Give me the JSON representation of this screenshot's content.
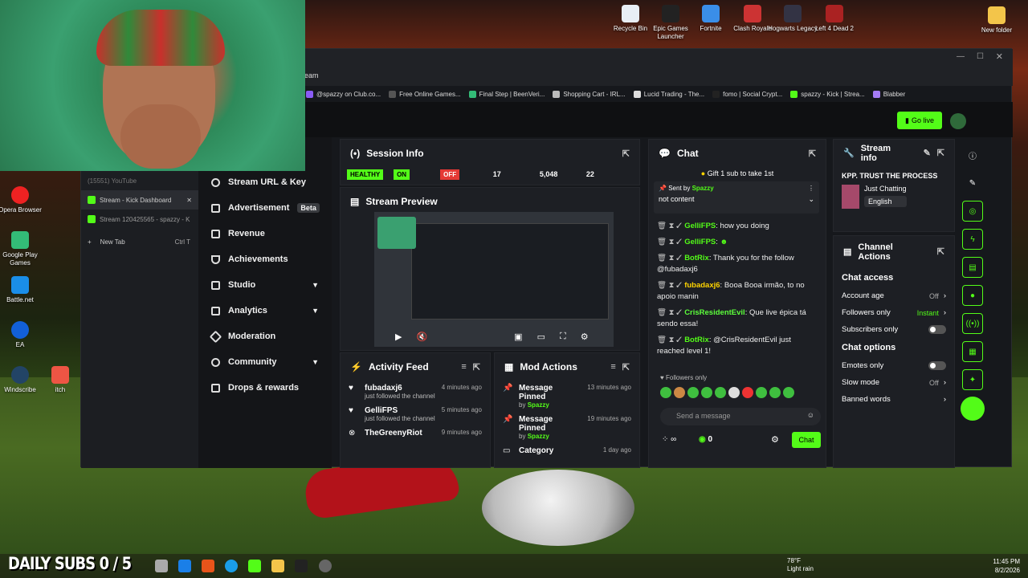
{
  "desktop": {
    "top_icons": [
      {
        "label": "Recycle Bin"
      },
      {
        "label": "Epic Games Launcher"
      },
      {
        "label": "Fortnite"
      },
      {
        "label": "Clash Royale"
      },
      {
        "label": "Hogwarts Legacy"
      },
      {
        "label": "Left 4 Dead 2"
      }
    ],
    "right_icon": "New folder",
    "left_icons": [
      {
        "label": "Opera Browser"
      },
      {
        "label": "Google Play Games"
      },
      {
        "label": "Battle.net"
      },
      {
        "label": "EA"
      },
      {
        "label": "Windscribe"
      },
      {
        "label": "itch"
      }
    ]
  },
  "browser": {
    "address": "eam",
    "bookmarks": [
      "@spazzy on Club.co...",
      "Free Online Games...",
      "Final Step | BeenVeri...",
      "Shopping Cart - IRL...",
      "Lucid Trading - The...",
      "fomo | Social Crypt...",
      "spazzy - Kick | Strea...",
      "Blabber"
    ],
    "tabs": [
      {
        "label": "(15551) YouTube"
      },
      {
        "label": "Stream - Kick Dashboard"
      },
      {
        "label": "Stream 120425565 - spazzy - K"
      }
    ],
    "new_tab": "New Tab",
    "new_tab_shortcut": "Ctrl  T"
  },
  "header": {
    "go_live": "Go live"
  },
  "nav": {
    "items": [
      {
        "label": "Stream URL & Key"
      },
      {
        "label": "Advertisement",
        "badge": "Beta"
      },
      {
        "label": "Revenue"
      },
      {
        "label": "Achievements"
      },
      {
        "label": "Studio"
      },
      {
        "label": "Analytics"
      },
      {
        "label": "Moderation"
      },
      {
        "label": "Community"
      },
      {
        "label": "Drops & rewards"
      }
    ]
  },
  "session": {
    "title": "Session Info",
    "health": "HEALTHY",
    "on": "ON",
    "off": "OFF",
    "stats": [
      "17",
      "5,048",
      "22"
    ]
  },
  "preview": {
    "title": "Stream Preview"
  },
  "activity": {
    "title": "Activity Feed",
    "rows": [
      {
        "name": "fubadaxj6",
        "sub": "just followed the channel",
        "time": "4 minutes ago"
      },
      {
        "name": "GelliFPS",
        "sub": "just followed the channel",
        "time": "5 minutes ago"
      },
      {
        "name": "TheGreenyRiot",
        "sub": "",
        "time": "9 minutes ago"
      }
    ]
  },
  "mod": {
    "title": "Mod Actions",
    "rows": [
      {
        "name": "Message Pinned",
        "by": "by",
        "user": "Spazzy",
        "time": "13 minutes ago"
      },
      {
        "name": "Message Pinned",
        "by": "by",
        "user": "Spazzy",
        "time": "19 minutes ago"
      },
      {
        "name": "Category",
        "by": "",
        "user": "",
        "time": "1 day ago"
      }
    ]
  },
  "chat": {
    "title": "Chat",
    "gift": "Gift 1 sub to take 1st",
    "pinned_by": "Sent by",
    "pinned_user": "Spazzy",
    "pinned_text": "not content",
    "messages": [
      {
        "user": "GelliFPS",
        "text": "how you doing"
      },
      {
        "user": "GelliFPS",
        "text": ""
      },
      {
        "user": "BotRix",
        "text": "Thank you for the follow @fubadaxj6"
      },
      {
        "user": "fubadaxj6",
        "text": "Booa Booa irmão, to no apoio manin"
      },
      {
        "user": "CrisResidentEvil",
        "text": "Que live épica tá sendo essa!"
      },
      {
        "user": "BotRix",
        "text": "@CrisResidentEvil just reached level 1!"
      }
    ],
    "followers_only": "Followers only",
    "send_placeholder": "Send a message",
    "count": "0",
    "chat_button": "Chat"
  },
  "stream_info": {
    "title": "Stream info",
    "stream_title": "KPP. TRUST THE PROCESS",
    "category": "Just Chatting",
    "language": "English"
  },
  "channel_actions": {
    "title": "Channel Actions",
    "chat_access": "Chat access",
    "rows": [
      {
        "label": "Account age",
        "value": "Off"
      },
      {
        "label": "Followers only",
        "value": "Instant"
      },
      {
        "label": "Subscribers only",
        "value": ""
      }
    ],
    "chat_options": "Chat options",
    "rows2": [
      {
        "label": "Emotes only",
        "value": ""
      },
      {
        "label": "Slow mode",
        "value": "Off"
      },
      {
        "label": "Banned words",
        "value": ""
      }
    ]
  },
  "taskbar": {
    "overlay": "DAILY SUBS 0 / 5",
    "temp": "78°F",
    "weather": "Light rain",
    "time": "11:45 PM",
    "date": "8/2/2026"
  }
}
